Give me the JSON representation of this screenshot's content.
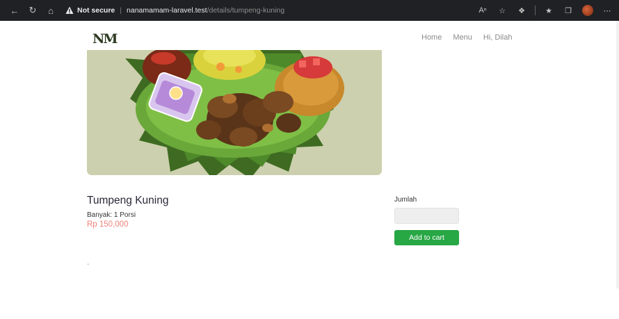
{
  "browser": {
    "not_secure_label": "Not secure",
    "url_host": "nanamamam-laravel.test",
    "url_path": "/details/tumpeng-kuning"
  },
  "site": {
    "logo": "NM",
    "nav": {
      "home": "Home",
      "menu": "Menu",
      "user_greeting": "Hi, Dilah"
    }
  },
  "product": {
    "title": "Tumpeng Kuning",
    "quantity_info": "Banyak: 1 Porsi",
    "price": "Rp 150,000",
    "description": "-"
  },
  "cart_form": {
    "quantity_label": "Jumlah",
    "quantity_value": "",
    "add_button_label": "Add to cart"
  },
  "colors": {
    "accent_green": "#28a745",
    "price_pink": "#f0807a",
    "hero_background": "#ccd0ae",
    "logo_dark_green": "#2c3a23"
  }
}
